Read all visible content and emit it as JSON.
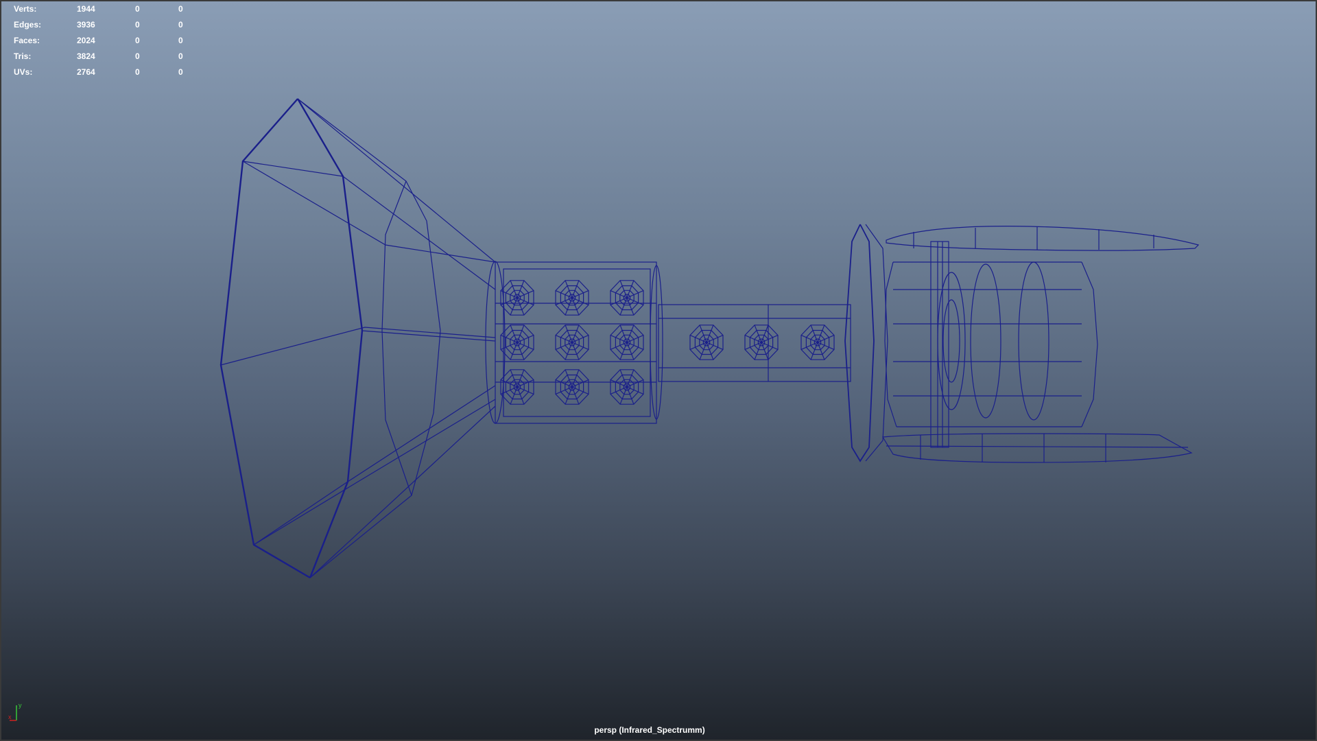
{
  "hud": {
    "rows": [
      {
        "label": "Verts:",
        "v1": "1944",
        "v2": "0",
        "v3": "0"
      },
      {
        "label": "Edges:",
        "v1": "3936",
        "v2": "0",
        "v3": "0"
      },
      {
        "label": "Faces:",
        "v1": "2024",
        "v2": "0",
        "v3": "0"
      },
      {
        "label": "Tris:",
        "v1": "3824",
        "v2": "0",
        "v3": "0"
      },
      {
        "label": "UVs:",
        "v1": "2764",
        "v2": "0",
        "v3": "0"
      }
    ]
  },
  "viewport": {
    "camera_label": "persp (Infrared_Spectrumm)",
    "wire_color": "#1a1f8a",
    "axis": {
      "y_label": "y",
      "x_label": "x",
      "y_color": "#38c838",
      "x_color": "#d02020"
    }
  }
}
